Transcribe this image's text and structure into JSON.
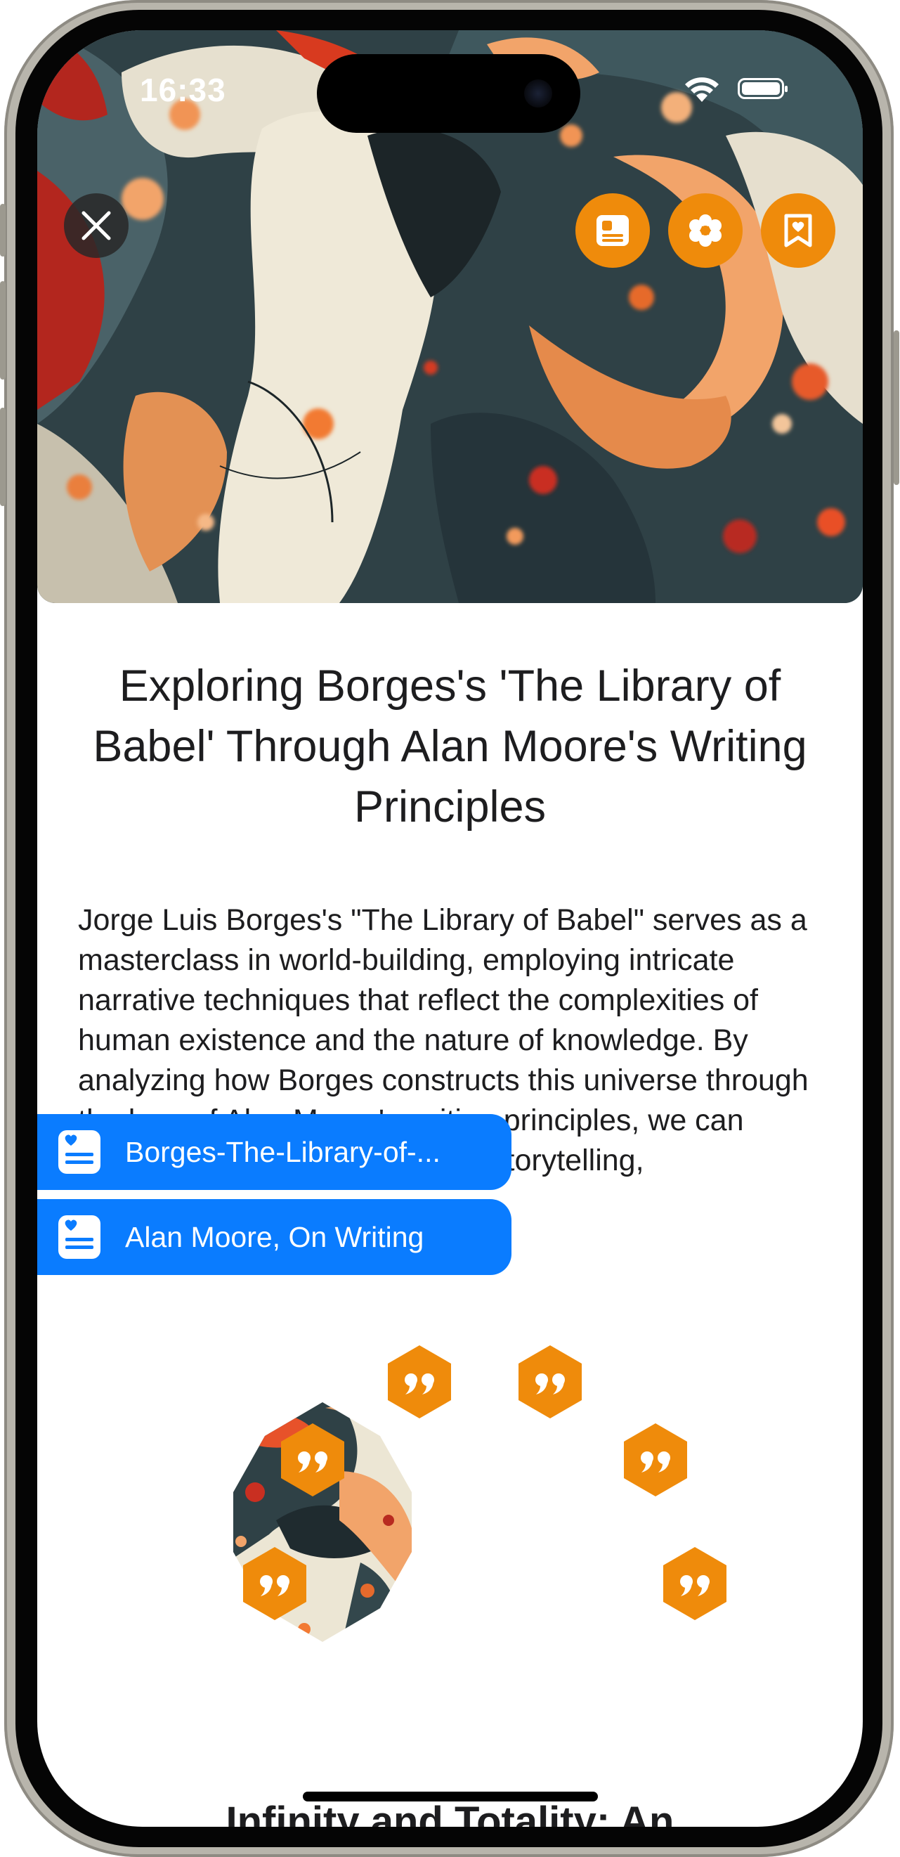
{
  "status_bar": {
    "time": "16:33"
  },
  "hero": {
    "close_icon": "close-icon",
    "actions": [
      {
        "icon": "card-icon"
      },
      {
        "icon": "flower-icon"
      },
      {
        "icon": "bookmark-heart-icon"
      }
    ]
  },
  "article": {
    "title": "Exploring Borges's 'The Library of Babel' Through Alan Moore's Writing Principles",
    "body": "Jorge Luis Borges's \"The Library of Babel\" serves as a masterclass in world-building, employing intricate narrative techniques that reflect the complexities of human existence and the nature of knowledge. By analyzing how Borges constructs this universe through the lens of Alan Moore's writing principles, we can uncover deeper insights about storytelling,",
    "next_heading": "Infinity and Totality: An"
  },
  "sources": [
    {
      "label": "Borges-The-Library-of-...",
      "icon": "note-heart-icon"
    },
    {
      "label": "Alan Moore, On Writing",
      "icon": "note-heart-icon"
    }
  ],
  "colors": {
    "accent_orange": "#ef8b0b",
    "chip_blue": "#0a7cff",
    "text": "#1d1d1f"
  }
}
